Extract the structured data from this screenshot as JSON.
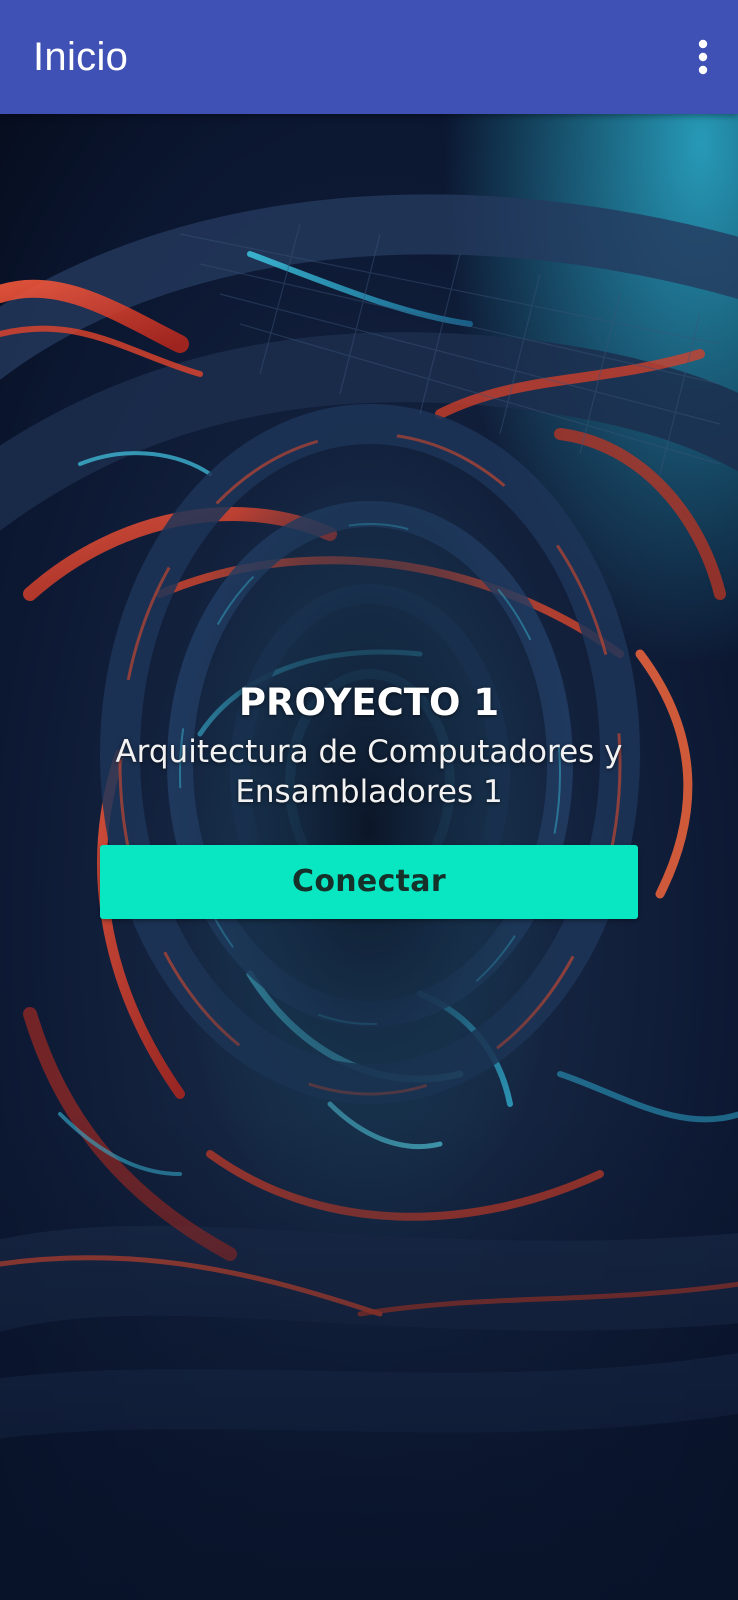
{
  "app_bar": {
    "title": "Inicio",
    "menu_icon": "more-vert-icon",
    "background_color": "#3f51b5"
  },
  "main": {
    "heading": "PROYECTO 1",
    "subtitle": "Arquitectura de Computadores y Ensambladores 1",
    "connect_button_label": "Conectar",
    "button_color": "#08e6c2",
    "background_image": "abstract-tunnel-wallpaper"
  }
}
